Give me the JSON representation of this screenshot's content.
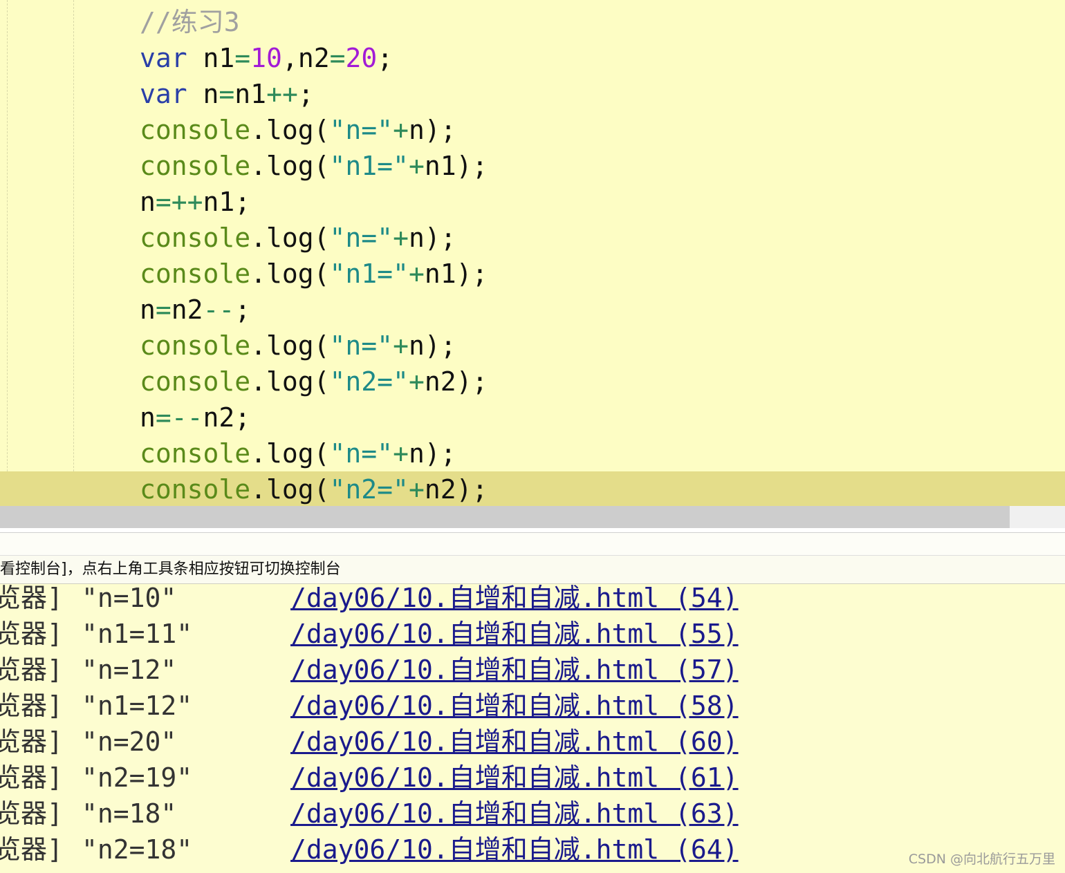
{
  "editor": {
    "lines": [
      {
        "tokens": [
          {
            "t": "//练习3",
            "c": "comment"
          }
        ]
      },
      {
        "tokens": [
          {
            "t": "var",
            "c": "keyword"
          },
          {
            "t": " n1",
            "c": "ident"
          },
          {
            "t": "=",
            "c": "op"
          },
          {
            "t": "10",
            "c": "number"
          },
          {
            "t": ",n2",
            "c": "ident"
          },
          {
            "t": "=",
            "c": "op"
          },
          {
            "t": "20",
            "c": "number"
          },
          {
            "t": ";",
            "c": "punct"
          }
        ]
      },
      {
        "tokens": [
          {
            "t": "var",
            "c": "keyword"
          },
          {
            "t": " n",
            "c": "ident"
          },
          {
            "t": "=",
            "c": "op"
          },
          {
            "t": "n1",
            "c": "ident"
          },
          {
            "t": "++",
            "c": "op"
          },
          {
            "t": ";",
            "c": "punct"
          }
        ]
      },
      {
        "tokens": [
          {
            "t": "console",
            "c": "console"
          },
          {
            "t": ".log(",
            "c": "punct"
          },
          {
            "t": "\"n=\"",
            "c": "string"
          },
          {
            "t": "+",
            "c": "op"
          },
          {
            "t": "n);",
            "c": "ident"
          }
        ]
      },
      {
        "tokens": [
          {
            "t": "console",
            "c": "console"
          },
          {
            "t": ".log(",
            "c": "punct"
          },
          {
            "t": "\"n1=\"",
            "c": "string"
          },
          {
            "t": "+",
            "c": "op"
          },
          {
            "t": "n1);",
            "c": "ident"
          }
        ]
      },
      {
        "tokens": [
          {
            "t": "n",
            "c": "ident"
          },
          {
            "t": "=++",
            "c": "op"
          },
          {
            "t": "n1;",
            "c": "ident"
          }
        ]
      },
      {
        "tokens": [
          {
            "t": "console",
            "c": "console"
          },
          {
            "t": ".log(",
            "c": "punct"
          },
          {
            "t": "\"n=\"",
            "c": "string"
          },
          {
            "t": "+",
            "c": "op"
          },
          {
            "t": "n);",
            "c": "ident"
          }
        ]
      },
      {
        "tokens": [
          {
            "t": "console",
            "c": "console"
          },
          {
            "t": ".log(",
            "c": "punct"
          },
          {
            "t": "\"n1=\"",
            "c": "string"
          },
          {
            "t": "+",
            "c": "op"
          },
          {
            "t": "n1);",
            "c": "ident"
          }
        ]
      },
      {
        "tokens": [
          {
            "t": "n",
            "c": "ident"
          },
          {
            "t": "=",
            "c": "op"
          },
          {
            "t": "n2",
            "c": "ident"
          },
          {
            "t": "--",
            "c": "op"
          },
          {
            "t": ";",
            "c": "punct"
          }
        ]
      },
      {
        "tokens": [
          {
            "t": "console",
            "c": "console"
          },
          {
            "t": ".log(",
            "c": "punct"
          },
          {
            "t": "\"n=\"",
            "c": "string"
          },
          {
            "t": "+",
            "c": "op"
          },
          {
            "t": "n);",
            "c": "ident"
          }
        ]
      },
      {
        "tokens": [
          {
            "t": "console",
            "c": "console"
          },
          {
            "t": ".log(",
            "c": "punct"
          },
          {
            "t": "\"n2=\"",
            "c": "string"
          },
          {
            "t": "+",
            "c": "op"
          },
          {
            "t": "n2);",
            "c": "ident"
          }
        ]
      },
      {
        "tokens": [
          {
            "t": "n",
            "c": "ident"
          },
          {
            "t": "=--",
            "c": "op"
          },
          {
            "t": "n2;",
            "c": "ident"
          }
        ]
      },
      {
        "tokens": [
          {
            "t": "console",
            "c": "console"
          },
          {
            "t": ".log(",
            "c": "punct"
          },
          {
            "t": "\"n=\"",
            "c": "string"
          },
          {
            "t": "+",
            "c": "op"
          },
          {
            "t": "n);",
            "c": "ident"
          }
        ]
      },
      {
        "tokens": [
          {
            "t": "console",
            "c": "console"
          },
          {
            "t": ".log(",
            "c": "punct"
          },
          {
            "t": "\"n2=\"",
            "c": "string"
          },
          {
            "t": "+",
            "c": "op"
          },
          {
            "t": "n2);",
            "c": "ident"
          }
        ],
        "active": true
      }
    ]
  },
  "console": {
    "hint": "看控制台]，点右上角工具条相应按钮可切换控制台",
    "rows": [
      {
        "prefix": "览器]",
        "message": "\"n=10\"",
        "link": "/day06/10.自增和自减.html (54)"
      },
      {
        "prefix": "览器]",
        "message": "\"n1=11\"",
        "link": "/day06/10.自增和自减.html (55)"
      },
      {
        "prefix": "览器]",
        "message": "\"n=12\"",
        "link": "/day06/10.自增和自减.html (57)"
      },
      {
        "prefix": "览器]",
        "message": "\"n1=12\"",
        "link": "/day06/10.自增和自减.html (58)"
      },
      {
        "prefix": "览器]",
        "message": "\"n=20\"",
        "link": "/day06/10.自增和自减.html (60)"
      },
      {
        "prefix": "览器]",
        "message": "\"n2=19\"",
        "link": "/day06/10.自增和自减.html (61)"
      },
      {
        "prefix": "览器]",
        "message": "\"n=18\"",
        "link": "/day06/10.自增和自减.html (63)"
      },
      {
        "prefix": "览器]",
        "message": "\"n2=18\"",
        "link": "/day06/10.自增和自减.html (64)"
      }
    ]
  },
  "watermark": "CSDN @向北航行五万里"
}
